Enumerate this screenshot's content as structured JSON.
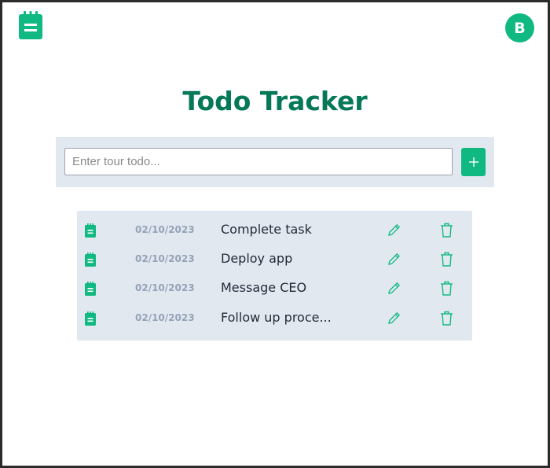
{
  "header": {
    "avatar_initial": "B",
    "logo_icon": "notepad-icon",
    "accent_color": "#10b981"
  },
  "title": "Todo Tracker",
  "input": {
    "placeholder": "Enter tour todo...",
    "value": "",
    "add_icon": "plus-icon"
  },
  "todos": [
    {
      "date": "02/10/2023",
      "text": "Complete task"
    },
    {
      "date": "02/10/2023",
      "text": "Deploy app"
    },
    {
      "date": "02/10/2023",
      "text": "Message CEO"
    },
    {
      "date": "02/10/2023",
      "text": "Follow up proce..."
    }
  ],
  "row_icons": {
    "item": "notepad-icon",
    "edit": "pencil-icon",
    "delete": "trash-icon"
  }
}
